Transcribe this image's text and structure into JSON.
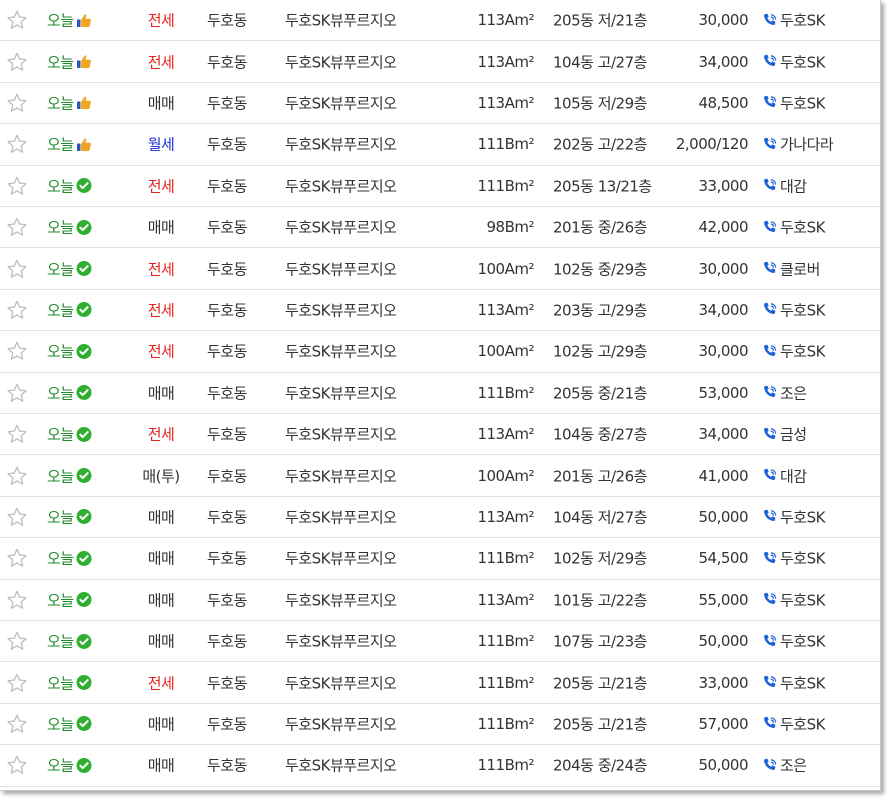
{
  "colors": {
    "today_green": "#1f8a2a",
    "jeonse_red": "#e8221e",
    "wolse_blue": "#1c2fd0",
    "maemae_gray": "#333333",
    "check_badge_green": "#2fae2f",
    "phone_blue": "#1d62d6",
    "star_outline": "#bdbdbd"
  },
  "listings": [
    {
      "date": "오늘",
      "badge": "thumbs-up-icon",
      "trade": "전세",
      "trade_kind": "jeonse",
      "dong": "두호동",
      "apt": "두호SK뷰푸르지오",
      "area": "113Am²",
      "floor": "205동 저/21층",
      "price": "30,000",
      "agent": "두호SK"
    },
    {
      "date": "오늘",
      "badge": "thumbs-up-icon",
      "trade": "전세",
      "trade_kind": "jeonse",
      "dong": "두호동",
      "apt": "두호SK뷰푸르지오",
      "area": "113Am²",
      "floor": "104동 고/27층",
      "price": "34,000",
      "agent": "두호SK"
    },
    {
      "date": "오늘",
      "badge": "thumbs-up-icon",
      "trade": "매매",
      "trade_kind": "maemae",
      "dong": "두호동",
      "apt": "두호SK뷰푸르지오",
      "area": "113Am²",
      "floor": "105동 저/29층",
      "price": "48,500",
      "agent": "두호SK"
    },
    {
      "date": "오늘",
      "badge": "thumbs-up-icon",
      "trade": "월세",
      "trade_kind": "wolse",
      "dong": "두호동",
      "apt": "두호SK뷰푸르지오",
      "area": "111Bm²",
      "floor": "202동 고/22층",
      "price": "2,000/120",
      "agent": "가나다라"
    },
    {
      "date": "오늘",
      "badge": "check-circle-icon",
      "trade": "전세",
      "trade_kind": "jeonse",
      "dong": "두호동",
      "apt": "두호SK뷰푸르지오",
      "area": "111Bm²",
      "floor": "205동 13/21층",
      "price": "33,000",
      "agent": "대감"
    },
    {
      "date": "오늘",
      "badge": "check-circle-icon",
      "trade": "매매",
      "trade_kind": "maemae",
      "dong": "두호동",
      "apt": "두호SK뷰푸르지오",
      "area": "98Bm²",
      "floor": "201동 중/26층",
      "price": "42,000",
      "agent": "두호SK"
    },
    {
      "date": "오늘",
      "badge": "check-circle-icon",
      "trade": "전세",
      "trade_kind": "jeonse",
      "dong": "두호동",
      "apt": "두호SK뷰푸르지오",
      "area": "100Am²",
      "floor": "102동 중/29층",
      "price": "30,000",
      "agent": "클로버"
    },
    {
      "date": "오늘",
      "badge": "check-circle-icon",
      "trade": "전세",
      "trade_kind": "jeonse",
      "dong": "두호동",
      "apt": "두호SK뷰푸르지오",
      "area": "113Am²",
      "floor": "203동 고/29층",
      "price": "34,000",
      "agent": "두호SK"
    },
    {
      "date": "오늘",
      "badge": "check-circle-icon",
      "trade": "전세",
      "trade_kind": "jeonse",
      "dong": "두호동",
      "apt": "두호SK뷰푸르지오",
      "area": "100Am²",
      "floor": "102동 고/29층",
      "price": "30,000",
      "agent": "두호SK"
    },
    {
      "date": "오늘",
      "badge": "check-circle-icon",
      "trade": "매매",
      "trade_kind": "maemae",
      "dong": "두호동",
      "apt": "두호SK뷰푸르지오",
      "area": "111Bm²",
      "floor": "205동 중/21층",
      "price": "53,000",
      "agent": "조은"
    },
    {
      "date": "오늘",
      "badge": "check-circle-icon",
      "trade": "전세",
      "trade_kind": "jeonse",
      "dong": "두호동",
      "apt": "두호SK뷰푸르지오",
      "area": "113Am²",
      "floor": "104동 중/27층",
      "price": "34,000",
      "agent": "금성"
    },
    {
      "date": "오늘",
      "badge": "check-circle-icon",
      "trade": "매(투)",
      "trade_kind": "maemae",
      "dong": "두호동",
      "apt": "두호SK뷰푸르지오",
      "area": "100Am²",
      "floor": "201동 고/26층",
      "price": "41,000",
      "agent": "대감"
    },
    {
      "date": "오늘",
      "badge": "check-circle-icon",
      "trade": "매매",
      "trade_kind": "maemae",
      "dong": "두호동",
      "apt": "두호SK뷰푸르지오",
      "area": "113Am²",
      "floor": "104동 저/27층",
      "price": "50,000",
      "agent": "두호SK"
    },
    {
      "date": "오늘",
      "badge": "check-circle-icon",
      "trade": "매매",
      "trade_kind": "maemae",
      "dong": "두호동",
      "apt": "두호SK뷰푸르지오",
      "area": "111Bm²",
      "floor": "102동 저/29층",
      "price": "54,500",
      "agent": "두호SK"
    },
    {
      "date": "오늘",
      "badge": "check-circle-icon",
      "trade": "매매",
      "trade_kind": "maemae",
      "dong": "두호동",
      "apt": "두호SK뷰푸르지오",
      "area": "113Am²",
      "floor": "101동 고/22층",
      "price": "55,000",
      "agent": "두호SK"
    },
    {
      "date": "오늘",
      "badge": "check-circle-icon",
      "trade": "매매",
      "trade_kind": "maemae",
      "dong": "두호동",
      "apt": "두호SK뷰푸르지오",
      "area": "111Bm²",
      "floor": "107동 고/23층",
      "price": "50,000",
      "agent": "두호SK"
    },
    {
      "date": "오늘",
      "badge": "check-circle-icon",
      "trade": "전세",
      "trade_kind": "jeonse",
      "dong": "두호동",
      "apt": "두호SK뷰푸르지오",
      "area": "111Bm²",
      "floor": "205동 고/21층",
      "price": "33,000",
      "agent": "두호SK"
    },
    {
      "date": "오늘",
      "badge": "check-circle-icon",
      "trade": "매매",
      "trade_kind": "maemae",
      "dong": "두호동",
      "apt": "두호SK뷰푸르지오",
      "area": "111Bm²",
      "floor": "205동 고/21층",
      "price": "57,000",
      "agent": "두호SK"
    },
    {
      "date": "오늘",
      "badge": "check-circle-icon",
      "trade": "매매",
      "trade_kind": "maemae",
      "dong": "두호동",
      "apt": "두호SK뷰푸르지오",
      "area": "111Bm²",
      "floor": "204동 중/24층",
      "price": "50,000",
      "agent": "조은"
    }
  ]
}
